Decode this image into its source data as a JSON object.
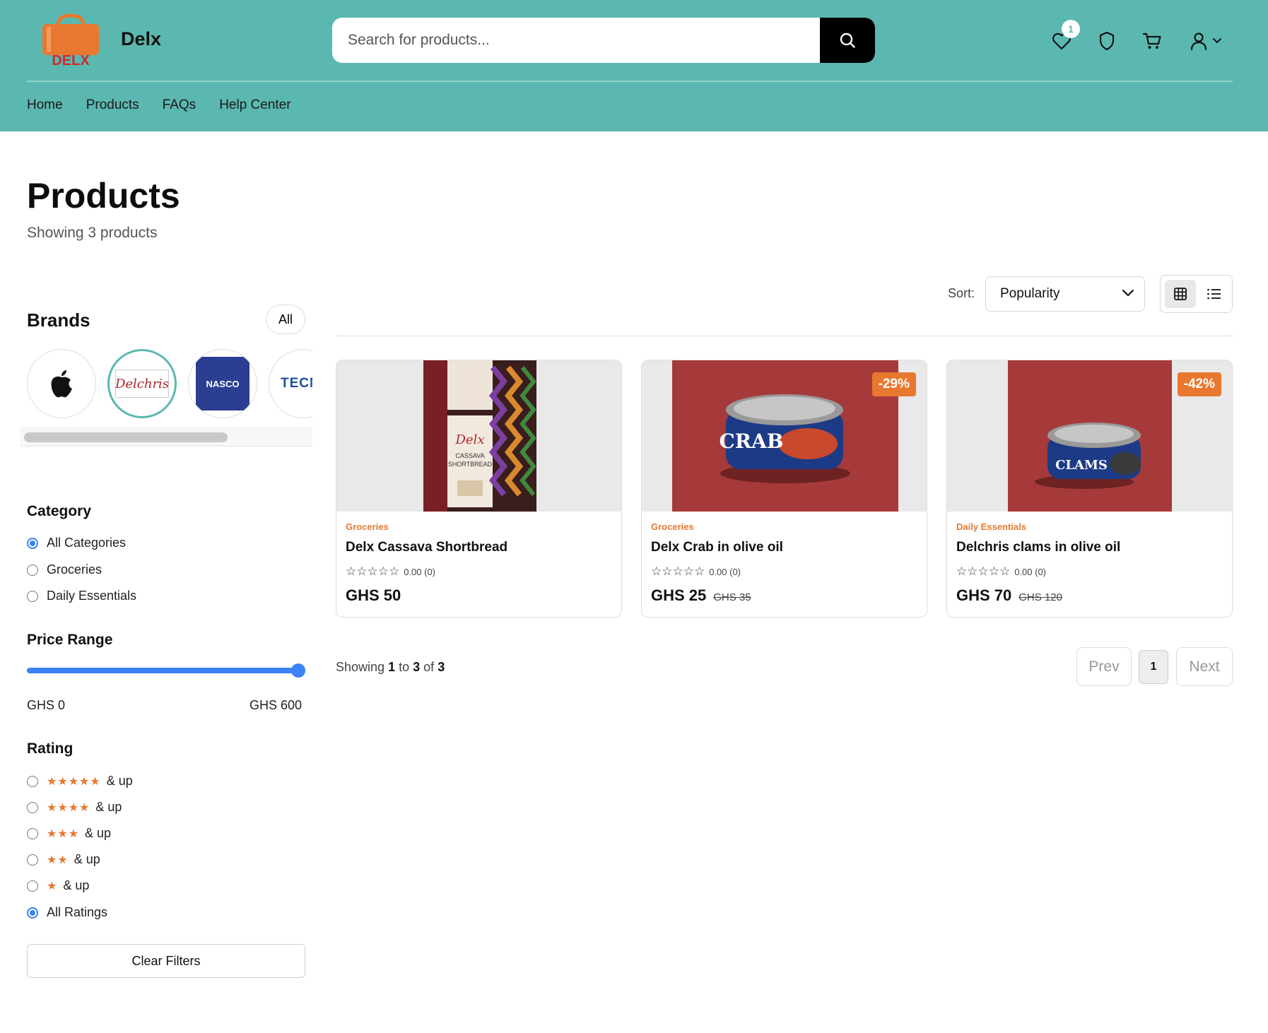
{
  "header": {
    "logo_text": "DELX",
    "brand_name": "Delx",
    "search_placeholder": "Search for products...",
    "wishlist_count": "1",
    "nav": [
      "Home",
      "Products",
      "FAQs",
      "Help Center"
    ]
  },
  "page": {
    "title": "Products",
    "subtitle": "Showing 3 products"
  },
  "sidebar": {
    "brands_title": "Brands",
    "brands_all": "All",
    "brands": [
      {
        "name": "apple",
        "logo_text": ""
      },
      {
        "name": "Delchris",
        "logo_text": "Delchris"
      },
      {
        "name": "NASCO",
        "logo_text": "NASCO"
      },
      {
        "name": "TECNO",
        "logo_text": "TECN"
      }
    ],
    "category_title": "Category",
    "categories": [
      "All Categories",
      "Groceries",
      "Daily Essentials"
    ],
    "category_selected": "All Categories",
    "price_title": "Price Range",
    "price_min": "GHS 0",
    "price_max": "GHS 600",
    "price_level": 1.0,
    "rating_title": "Rating",
    "ratings": [
      {
        "stars": 5,
        "label": "& up"
      },
      {
        "stars": 4,
        "label": "& up"
      },
      {
        "stars": 3,
        "label": "& up"
      },
      {
        "stars": 2,
        "label": "& up"
      },
      {
        "stars": 1,
        "label": "& up"
      }
    ],
    "all_ratings": "All Ratings",
    "clear_filters": "Clear Filters"
  },
  "toolbar": {
    "sort_label": "Sort:",
    "sort_value": "Popularity",
    "view": "grid"
  },
  "products": [
    {
      "category": "Groceries",
      "name": "Delx Cassava Shortbread",
      "rating": "0.00 (0)",
      "price": "GHS 50",
      "old_price": "",
      "discount": "",
      "image_text": "Delx CASSAVA SHORTBREAD"
    },
    {
      "category": "Groceries",
      "name": "Delx Crab in olive oil",
      "rating": "0.00 (0)",
      "price": "GHS 25",
      "old_price": "GHS 35",
      "discount": "-29%",
      "image_text": "CRAB"
    },
    {
      "category": "Daily Essentials",
      "name": "Delchris clams in olive oil",
      "rating": "0.00 (0)",
      "price": "GHS 70",
      "old_price": "GHS 120",
      "discount": "-42%",
      "image_text": "CLAMS"
    }
  ],
  "pagination": {
    "showing_prefix": "Showing",
    "from": "1",
    "to_word": "to",
    "to": "3",
    "of_word": "of",
    "total": "3",
    "prev": "Prev",
    "current": "1",
    "next": "Next"
  },
  "colors": {
    "header_bg": "#5bb8b0",
    "accent_orange": "#e8782f",
    "accent_blue": "#3b82f6"
  }
}
